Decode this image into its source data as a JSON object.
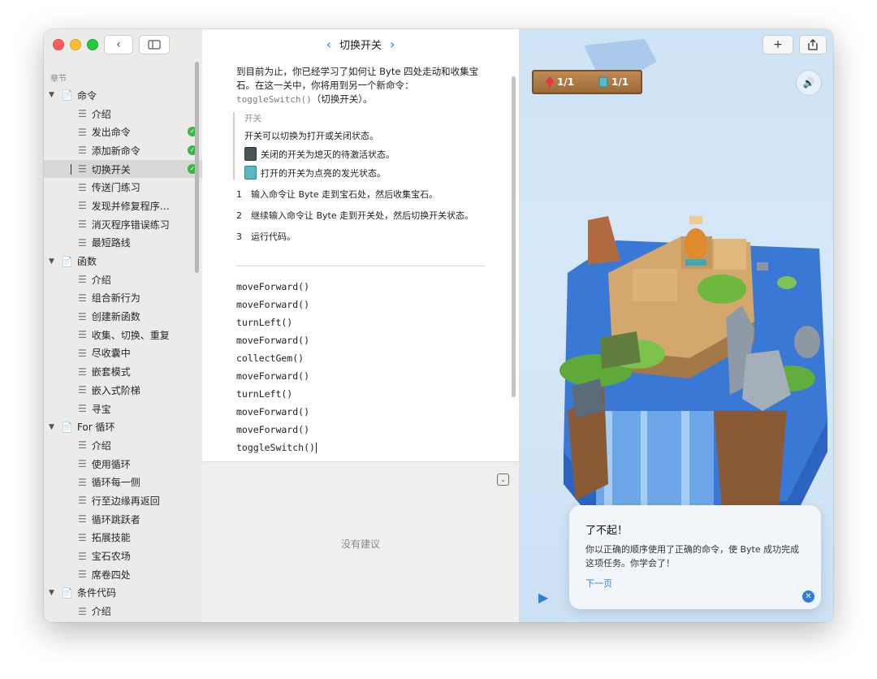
{
  "sidebar": {
    "section_label": "章节",
    "chapters": [
      {
        "name": "命令",
        "lessons": [
          {
            "name": "介绍"
          },
          {
            "name": "发出命令",
            "done": true
          },
          {
            "name": "添加新命令",
            "done": true
          },
          {
            "name": "切换开关",
            "done": true,
            "selected": true
          },
          {
            "name": "传送门练习"
          },
          {
            "name": "发现并修复程序…"
          },
          {
            "name": "消灭程序错误练习"
          },
          {
            "name": "最短路线"
          }
        ]
      },
      {
        "name": "函数",
        "lessons": [
          {
            "name": "介绍"
          },
          {
            "name": "组合新行为"
          },
          {
            "name": "创建新函数"
          },
          {
            "name": "收集、切换、重复"
          },
          {
            "name": "尽收囊中"
          },
          {
            "name": "嵌套模式"
          },
          {
            "name": "嵌入式阶梯"
          },
          {
            "name": "寻宝"
          }
        ]
      },
      {
        "name": "For 循环",
        "lessons": [
          {
            "name": "介绍"
          },
          {
            "name": "使用循环"
          },
          {
            "name": "循环每一侧"
          },
          {
            "name": "行至边缘再返回"
          },
          {
            "name": "循环跳跃者"
          },
          {
            "name": "拓展技能"
          },
          {
            "name": "宝石农场"
          },
          {
            "name": "席卷四处"
          }
        ]
      },
      {
        "name": "条件代码",
        "lessons": [
          {
            "name": "介绍"
          }
        ]
      }
    ]
  },
  "editor": {
    "title": "切换开关",
    "intro_line1": "到目前为止，你已经学习了如何让 Byte 四处走动和收集宝石。在这一关中，你将用到另一个新命令：",
    "intro_code": "toggleSwitch()",
    "intro_line2": "（切换开关）。",
    "callout_title": "开关",
    "callout_line": "开关可以切换为打开或关闭状态。",
    "callout_off": "关闭的开关为熄灭的待激活状态。",
    "callout_on": "打开的开关为点亮的发光状态。",
    "steps": [
      {
        "num": "1",
        "text": "输入命令让 Byte 走到宝石处，然后收集宝石。"
      },
      {
        "num": "2",
        "text": "继续输入命令让 Byte 走到开关处，然后切换开关状态。"
      },
      {
        "num": "3",
        "text": "运行代码。"
      }
    ],
    "code_lines": [
      "moveForward()",
      "moveForward()",
      "turnLeft()",
      "moveForward()",
      "collectGem()",
      "moveForward()",
      "turnLeft()",
      "moveForward()",
      "moveForward()",
      "toggleSwitch()"
    ],
    "no_suggestion": "没有建议"
  },
  "scene": {
    "gem_count": "1/1",
    "switch_count": "1/1",
    "popup_title": "了不起！",
    "popup_body": "你以正确的顺序使用了正确的命令，使 Byte 成功完成这项任务。你学会了！",
    "popup_next": "下一页"
  },
  "colors": {
    "accent": "#2f7de1",
    "check": "#39b54a",
    "water": "#3a78d6"
  }
}
